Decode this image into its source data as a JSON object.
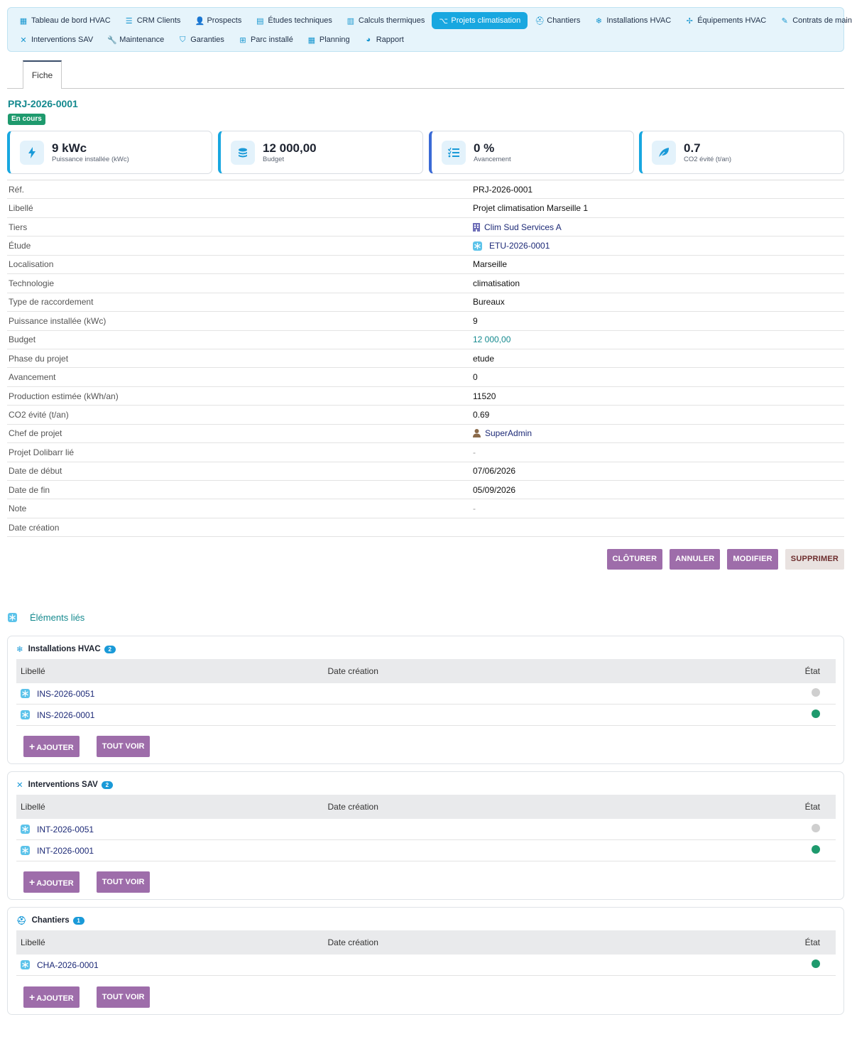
{
  "menu": {
    "row1": [
      {
        "label": "Tableau de bord HVAC",
        "icon": "dashboard-icon"
      },
      {
        "label": "CRM Clients",
        "icon": "list-icon"
      },
      {
        "label": "Prospects",
        "icon": "user-plus-icon"
      },
      {
        "label": "Études techniques",
        "icon": "clipboard-icon"
      },
      {
        "label": "Calculs thermiques",
        "icon": "calculator-icon"
      },
      {
        "label": "Projets climatisation",
        "icon": "project-diagram-icon",
        "active": true
      },
      {
        "label": "Chantiers",
        "icon": "hard-hat-icon"
      },
      {
        "label": "Installations HVAC",
        "icon": "snowflake-icon"
      },
      {
        "label": "Équipements HVAC",
        "icon": "fan-icon"
      },
      {
        "label": "Contrats de maintenance",
        "icon": "contract-icon"
      }
    ],
    "row2": [
      {
        "label": "Interventions SAV",
        "icon": "tools-icon"
      },
      {
        "label": "Maintenance",
        "icon": "wrench-icon"
      },
      {
        "label": "Garanties",
        "icon": "shield-icon"
      },
      {
        "label": "Parc installé",
        "icon": "sitemap-icon"
      },
      {
        "label": "Planning",
        "icon": "calendar-icon"
      },
      {
        "label": "Rapport",
        "icon": "chart-pie-icon"
      }
    ]
  },
  "tabs": {
    "fiche": "Fiche"
  },
  "record": {
    "ref": "PRJ-2026-0001",
    "status": "En cours"
  },
  "kpis": [
    {
      "value": "9 kWc",
      "label": "Puissance installée (kWc)",
      "icon": "bolt-icon"
    },
    {
      "value": "12 000,00",
      "label": "Budget",
      "icon": "coins-icon"
    },
    {
      "value": "0 %",
      "label": "Avancement",
      "icon": "tasks-icon"
    },
    {
      "value": "0.7",
      "label": "CO2 évité (t/an)",
      "icon": "leaf-icon"
    }
  ],
  "fields": [
    {
      "label": "Réf.",
      "value": "PRJ-2026-0001"
    },
    {
      "label": "Libellé",
      "value": "Projet climatisation Marseille 1"
    },
    {
      "label": "Tiers",
      "value": "Clim Sud Services A",
      "icon": "building-icon",
      "link": true
    },
    {
      "label": "Étude",
      "value": "ETU-2026-0001",
      "icon": "snowflake-icon",
      "link": true
    },
    {
      "label": "Localisation",
      "value": "Marseille"
    },
    {
      "label": "Technologie",
      "value": "climatisation"
    },
    {
      "label": "Type de raccordement",
      "value": "Bureaux"
    },
    {
      "label": "Puissance installée (kWc)",
      "value": "9"
    },
    {
      "label": "Budget",
      "value": "12 000,00",
      "amount": true
    },
    {
      "label": "Phase du projet",
      "value": "etude"
    },
    {
      "label": "Avancement",
      "value": "0"
    },
    {
      "label": "Production estimée (kWh/an)",
      "value": "11520"
    },
    {
      "label": "CO2 évité (t/an)",
      "value": "0.69"
    },
    {
      "label": "Chef de projet",
      "value": "SuperAdmin",
      "icon": "user-icon",
      "link": true
    },
    {
      "label": "Projet Dolibarr lié",
      "value": "-",
      "dash": true
    },
    {
      "label": "Date de début",
      "value": "07/06/2026"
    },
    {
      "label": "Date de fin",
      "value": "05/09/2026"
    },
    {
      "label": "Note",
      "value": "-",
      "dash": true
    },
    {
      "label": "Date création",
      "value": ""
    }
  ],
  "actions": {
    "close": "CLÔTURER",
    "cancel": "ANNULER",
    "edit": "MODIFIER",
    "delete": "SUPPRIMER"
  },
  "linked": {
    "title": "Éléments liés"
  },
  "panels": [
    {
      "title": "Installations HVAC",
      "count": "2",
      "icon": "snowflake-icon",
      "columns": [
        "Libellé",
        "Date création",
        "État"
      ],
      "rows": [
        {
          "label": "INS-2026-0051",
          "date": "",
          "state": "grey"
        },
        {
          "label": "INS-2026-0001",
          "date": "",
          "state": "green"
        }
      ],
      "add": "AJOUTER",
      "all": "TOUT VOIR"
    },
    {
      "title": "Interventions SAV",
      "count": "2",
      "icon": "tools-icon",
      "columns": [
        "Libellé",
        "Date création",
        "État"
      ],
      "rows": [
        {
          "label": "INT-2026-0051",
          "date": "",
          "state": "grey"
        },
        {
          "label": "INT-2026-0001",
          "date": "",
          "state": "green"
        }
      ],
      "add": "AJOUTER",
      "all": "TOUT VOIR"
    },
    {
      "title": "Chantiers",
      "count": "1",
      "icon": "hard-hat-icon",
      "columns": [
        "Libellé",
        "Date création",
        "État"
      ],
      "rows": [
        {
          "label": "CHA-2026-0001",
          "date": "",
          "state": "green"
        }
      ],
      "add": "AJOUTER",
      "all": "TOUT VOIR"
    }
  ],
  "colors": {
    "accent": "#18a7e0",
    "teal": "#14898e",
    "button": "#9e6daa",
    "success": "#1e9a6d"
  }
}
